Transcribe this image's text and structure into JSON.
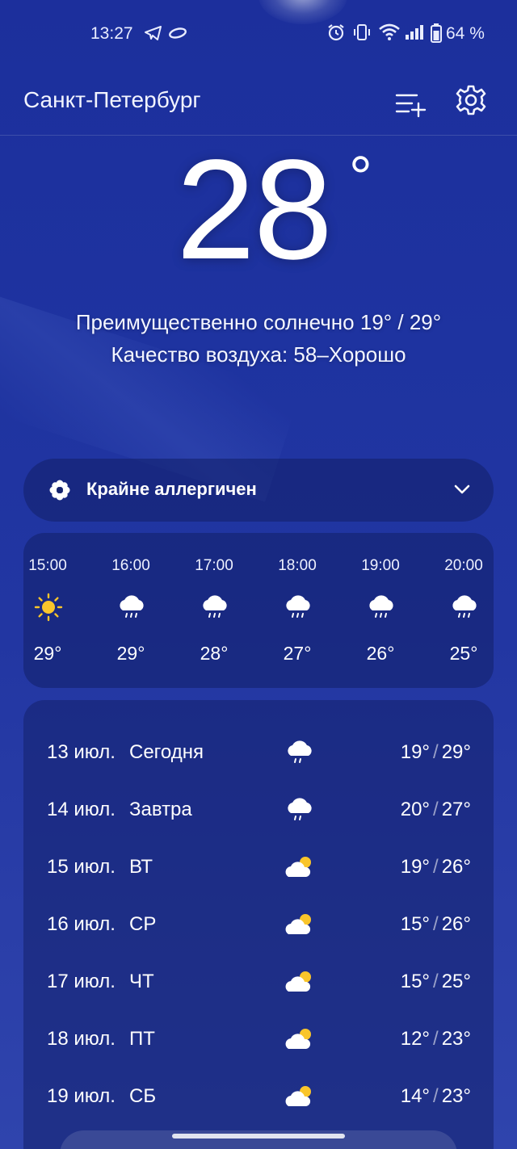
{
  "status_bar": {
    "time": "13:27",
    "battery": "64 %",
    "icons": [
      "telegram-icon",
      "app-ring-icon",
      "alarm-icon",
      "vibrate-icon",
      "wifi-icon",
      "signal-icon",
      "battery-icon"
    ]
  },
  "header": {
    "city": "Санкт-Петербург",
    "icons": [
      "add-location-icon",
      "gear-icon"
    ]
  },
  "current": {
    "temperature": "28",
    "degree": "°",
    "condition": "Преимущественно солнечно  19° / 29°",
    "air_quality": "Качество воздуха: 58–Хорошо"
  },
  "allergy": {
    "label": "Крайне аллергичен",
    "icon": "pollen-icon"
  },
  "hourly": [
    {
      "time": "15:00",
      "icon": "sun-icon",
      "temp": "29°"
    },
    {
      "time": "16:00",
      "icon": "rain-cloud-icon",
      "temp": "29°"
    },
    {
      "time": "17:00",
      "icon": "rain-cloud-icon",
      "temp": "28°"
    },
    {
      "time": "18:00",
      "icon": "rain-cloud-icon",
      "temp": "27°"
    },
    {
      "time": "19:00",
      "icon": "rain-cloud-icon",
      "temp": "26°"
    },
    {
      "time": "20:00",
      "icon": "rain-cloud-icon",
      "temp": "25°"
    }
  ],
  "daily": [
    {
      "date": "13 июл.",
      "name": "Сегодня",
      "icon": "rain-cloud-icon",
      "low": "19°",
      "high": "29°"
    },
    {
      "date": "14 июл.",
      "name": "Завтра",
      "icon": "rain-cloud-icon",
      "low": "20°",
      "high": "27°"
    },
    {
      "date": "15 июл.",
      "name": "ВТ",
      "icon": "partly-cloudy-icon",
      "low": "19°",
      "high": "26°"
    },
    {
      "date": "16 июл.",
      "name": "СР",
      "icon": "partly-cloudy-icon",
      "low": "15°",
      "high": "26°"
    },
    {
      "date": "17 июл.",
      "name": "ЧТ",
      "icon": "partly-cloudy-icon",
      "low": "15°",
      "high": "25°"
    },
    {
      "date": "18 июл.",
      "name": "ПТ",
      "icon": "partly-cloudy-icon",
      "low": "12°",
      "high": "23°"
    },
    {
      "date": "19 июл.",
      "name": "СБ",
      "icon": "partly-cloudy-icon",
      "low": "14°",
      "high": "23°"
    }
  ],
  "colors": {
    "background": "#1e33a0",
    "card": "#16246e",
    "sun": "#f9c52b"
  }
}
